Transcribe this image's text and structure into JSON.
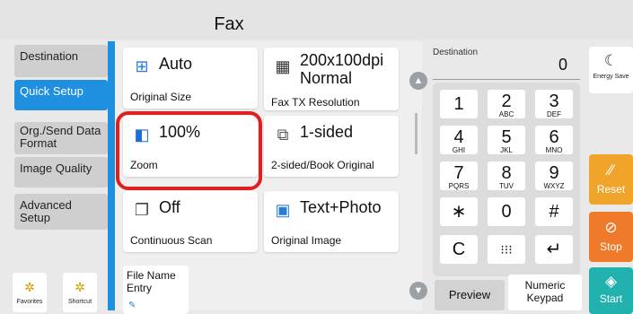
{
  "header": {
    "title": "Fax"
  },
  "sidebar": {
    "tabs": [
      {
        "label": "Destination",
        "active": false
      },
      {
        "label": "Quick Setup",
        "active": true
      },
      {
        "label": "Org./Send Data Format",
        "active": false
      },
      {
        "label": "Image Quality",
        "active": false
      },
      {
        "label": "Advanced Setup",
        "active": false
      }
    ],
    "shortcuts": [
      {
        "label": "Favorites",
        "icon": "gear-star-icon"
      },
      {
        "label": "Shortcut",
        "icon": "gear-star-icon"
      }
    ]
  },
  "tiles": {
    "original_size": {
      "value": "Auto",
      "label": "Original Size",
      "icon": "original-size-icon"
    },
    "fax_resolution": {
      "value_line1": "200x100dpi",
      "value_line2": "Normal",
      "label": "Fax TX Resolution",
      "icon": "resolution-icon"
    },
    "zoom": {
      "value": "100%",
      "label": "Zoom",
      "icon": "zoom-icon"
    },
    "duplex": {
      "value": "1-sided",
      "label": "2-sided/Book Original",
      "icon": "duplex-icon"
    },
    "continuous_scan": {
      "value": "Off",
      "label": "Continuous Scan",
      "icon": "continuous-scan-icon"
    },
    "original_image": {
      "value": "Text+Photo",
      "label": "Original Image",
      "icon": "original-image-icon"
    },
    "file_name": {
      "label_line1": "File Name",
      "label_line2": "Entry",
      "icon": "pencil-icon"
    }
  },
  "destination": {
    "label": "Destination",
    "count": "0"
  },
  "keypad": {
    "keys": [
      {
        "num": "1",
        "sub": ""
      },
      {
        "num": "2",
        "sub": "ABC"
      },
      {
        "num": "3",
        "sub": "DEF"
      },
      {
        "num": "4",
        "sub": "GHI"
      },
      {
        "num": "5",
        "sub": "JKL"
      },
      {
        "num": "6",
        "sub": "MNO"
      },
      {
        "num": "7",
        "sub": "PQRS"
      },
      {
        "num": "8",
        "sub": "TUV"
      },
      {
        "num": "9",
        "sub": "WXYZ"
      },
      {
        "num": "∗",
        "sub": ""
      },
      {
        "num": "0",
        "sub": ""
      },
      {
        "num": "#",
        "sub": ""
      },
      {
        "num": "C",
        "sub": ""
      },
      {
        "num": "⁝⁝⁝",
        "sub": ""
      },
      {
        "num": "↵",
        "sub": ""
      }
    ]
  },
  "right_buttons": {
    "energy": {
      "label": "Energy Save",
      "icon": "moon-icon"
    },
    "reset": {
      "label": "Reset",
      "icon": "reset-icon"
    },
    "stop": {
      "label": "Stop",
      "icon": "stop-icon"
    },
    "start": {
      "label": "Start",
      "icon": "start-icon"
    }
  },
  "bottom": {
    "preview_label": "Preview",
    "keypad_line1": "Numeric",
    "keypad_line2": "Keypad"
  },
  "colors": {
    "accent": "#1f8fe0",
    "highlight": "#e02020",
    "reset": "#f0a52a",
    "stop": "#ef7a2a",
    "start": "#21b2b0"
  }
}
